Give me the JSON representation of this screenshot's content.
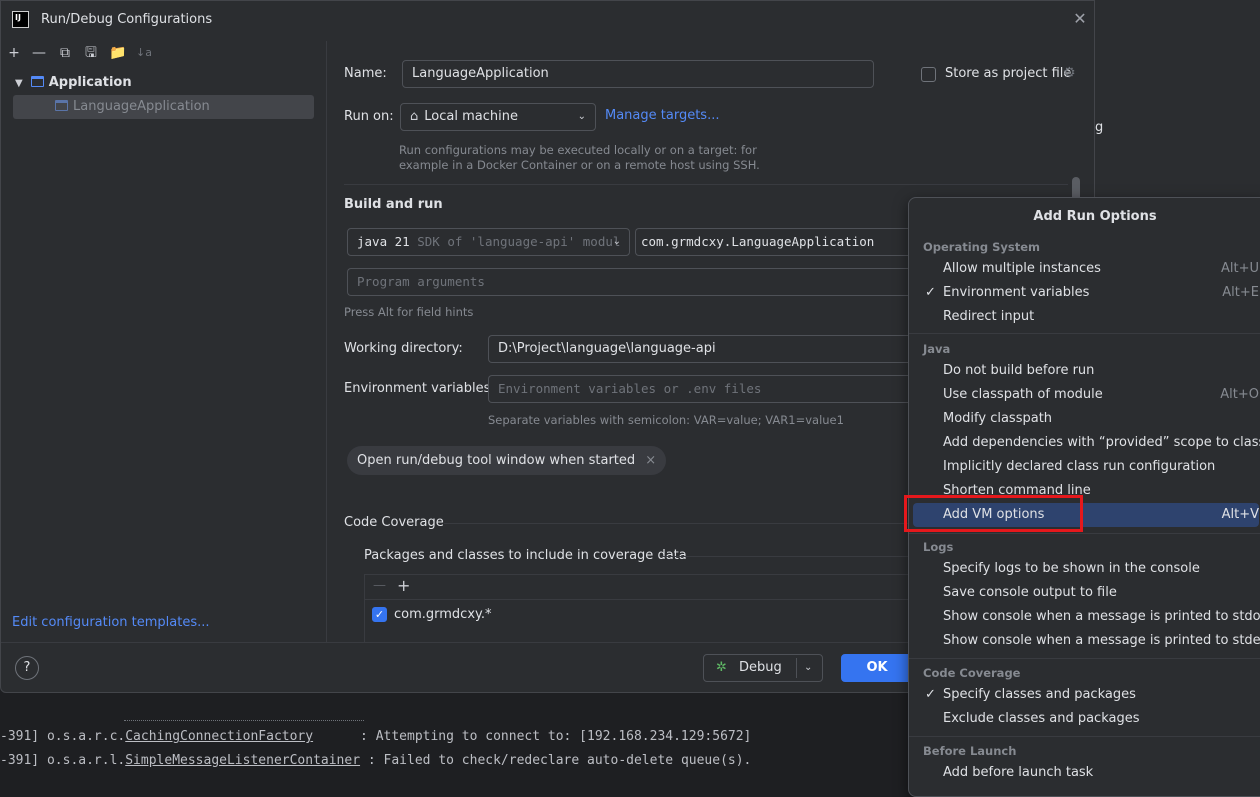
{
  "window": {
    "title": "Run/Debug Configurations",
    "app_icon_text": "IJ"
  },
  "background": {
    "snippet_g": "g"
  },
  "toolbar": {
    "add": "+",
    "remove": "—",
    "copy": "⧉",
    "save": "🖫",
    "folder": "📁",
    "sort": "↓a"
  },
  "tree": {
    "group": "Application",
    "item": "LanguageApplication"
  },
  "left_footer": {
    "edit_templates": "Edit configuration templates..."
  },
  "form": {
    "name_label": "Name:",
    "name_value": "LanguageApplication",
    "store_label": "Store as project file",
    "run_on_label": "Run on:",
    "run_on_value": "Local machine",
    "manage_targets": "Manage targets...",
    "run_on_hint_1": "Run configurations may be executed locally or on a target: for",
    "run_on_hint_2": "example in a Docker Container or on a remote host using SSH.",
    "build_run_title": "Build and run",
    "sdk_java": "java 21",
    "sdk_rest": "SDK of 'language-api' modul",
    "main_class_prefix": "com.grmdcxy.",
    "main_class_name": "LanguageApplication",
    "program_args_placeholder": "Program arguments",
    "alt_hint": "Press Alt for field hints",
    "working_dir_label": "Working directory:",
    "working_dir_value": "D:\\Project\\language\\language-api",
    "env_label": "Environment variables:",
    "env_placeholder": "Environment variables or .env files",
    "env_hint": "Separate variables with semicolon: VAR=value; VAR1=value1",
    "chip": "Open run/debug tool window when started",
    "chip_close": "×",
    "coverage_title": "Code Coverage",
    "coverage_packages_label": "Packages and classes to include in coverage data",
    "coverage_minus": "—",
    "coverage_plus": "+",
    "coverage_pkg": "com.grmdcxy.*"
  },
  "footer": {
    "help": "?",
    "debug": "Debug",
    "ok": "OK"
  },
  "popup": {
    "title": "Add Run Options",
    "groups": {
      "os": "Operating System",
      "java": "Java",
      "logs": "Logs",
      "coverage": "Code Coverage",
      "before": "Before Launch"
    },
    "items": {
      "allow_multiple": "Allow multiple instances",
      "allow_multiple_sc": "Alt+U",
      "env_vars": "Environment variables",
      "env_vars_sc": "Alt+E",
      "redirect_input": "Redirect input",
      "no_build": "Do not build before run",
      "classpath_module": "Use classpath of module",
      "classpath_module_sc": "Alt+O",
      "modify_classpath": "Modify classpath",
      "add_deps": "Add dependencies with “provided” scope to classpath",
      "implicit": "Implicitly declared class run configuration",
      "shorten": "Shorten command line",
      "vm_options": "Add VM options",
      "vm_options_sc": "Alt+V",
      "logs_console": "Specify logs to be shown in the console",
      "save_console": "Save console output to file",
      "stdout": "Show console when a message is printed to stdout",
      "stderr": "Show console when a message is printed to stderr",
      "specify_classes": "Specify classes and packages",
      "exclude_classes": "Exclude classes and packages",
      "before_task": "Add before launch task"
    },
    "checkmark": "✓"
  },
  "console": {
    "line1_prefix": "-391] o.s.a.r.c.",
    "line1_class": "CachingConnectionFactory",
    "line1_msg": "      : Attempting to connect to: [192.168.234.129:5672]",
    "line2_prefix": "-391] o.s.a.r.l.",
    "line2_class": "SimpleMessageListenerContainer",
    "line2_msg": " : Failed to check/redeclare auto-delete queue(s)."
  },
  "colors": {
    "accent": "#3574f0",
    "link": "#548af7",
    "highlight_box": "#e5181c",
    "selected_item": "#2e436e"
  }
}
